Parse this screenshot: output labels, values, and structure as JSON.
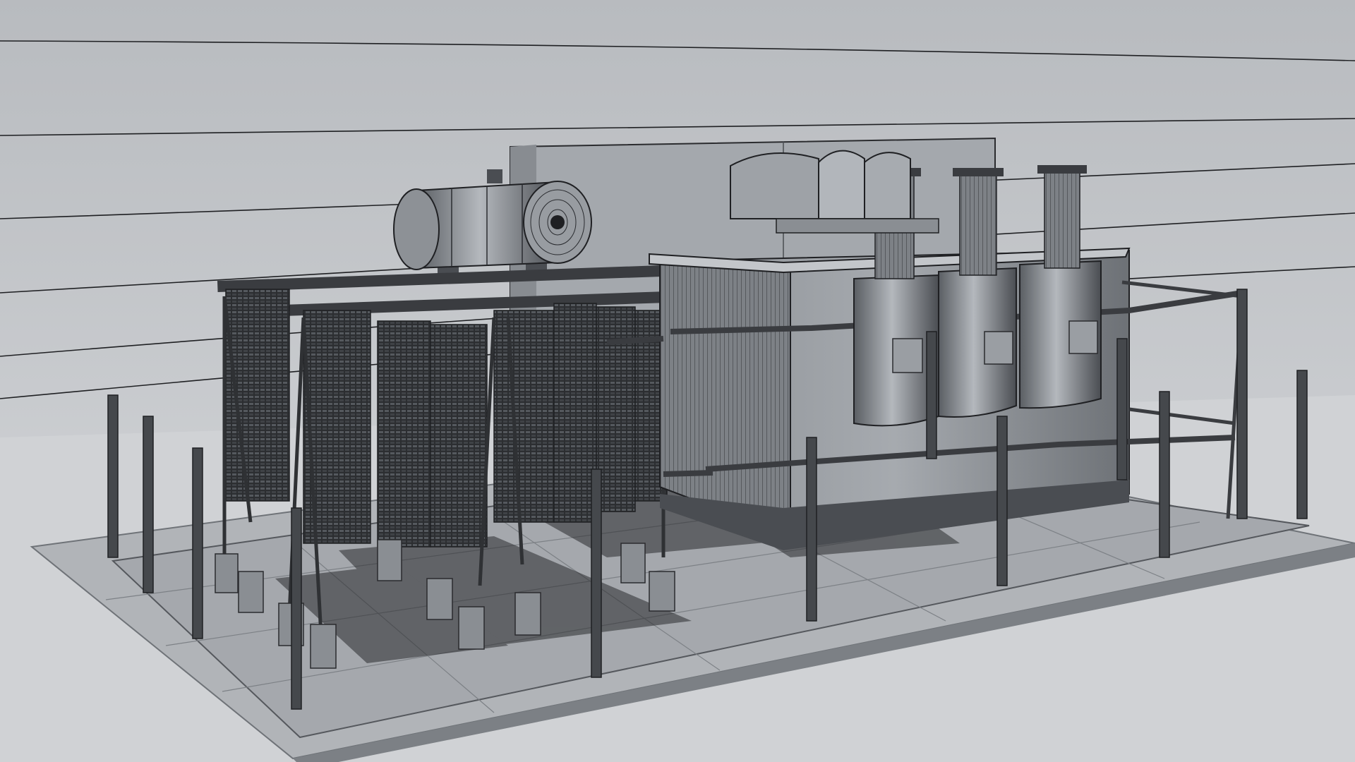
{
  "scene": {
    "subject": "transformer-wireframe-render",
    "colors": {
      "sky_top": "#b9bcc0",
      "sky_bottom": "#d6d8db",
      "ground": "#d2d4d7",
      "slab": "#b3b6ba",
      "slab_edge": "#8e9196",
      "metal_dark": "#3a3c40",
      "metal_mid": "#6f7378",
      "metal_light": "#a9adb2",
      "wire": "#1f2023",
      "shadow": "#2a2b2e"
    },
    "counts": {
      "radiator_banks": 8,
      "bushings": 3,
      "fence_posts": 12
    }
  }
}
